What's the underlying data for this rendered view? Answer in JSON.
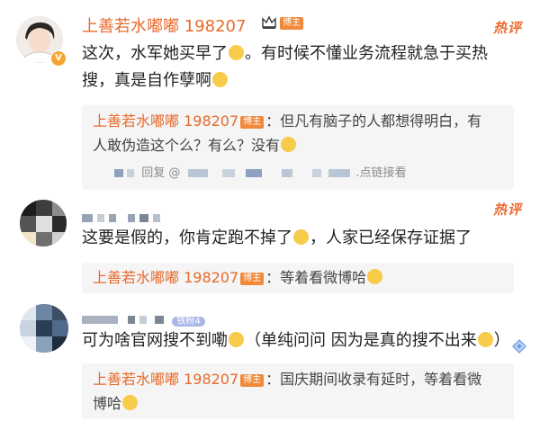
{
  "post": {
    "author": "上善若水嘟嘟 198207",
    "badge": "博主",
    "hot_label": "热评",
    "text_1": "这次，水军她买早了",
    "text_2": "。有时候不懂业务流程就急于买热",
    "text_3": "搜，真是自作孽啊",
    "reply": {
      "author": "上善若水嘟嘟 198207",
      "badge": "博主",
      "text_1": "：但凡有脑子的人都想得明白，有",
      "text_2": "人敢伪造这个么？有么？没有",
      "footer_reply": "回复 @",
      "footer_link": "点链接看"
    }
  },
  "comment2": {
    "hot_label": "热评",
    "text": "这要是假的，你肯定跑不掉了",
    "text_tail": "，人家已经保存证据了",
    "reply": {
      "author": "上善若水嘟嘟 198207",
      "badge": "博主",
      "text": "：等着看微博哈"
    }
  },
  "comment3": {
    "fan_badge": "铁粉4",
    "text": "可为啥官网搜不到嘞",
    "text_tail": "（单纯问问 因为是真的搜不出来",
    "text_end": "）",
    "reply": {
      "author": "上善若水嘟嘟 198207",
      "badge": "博主",
      "text_1": "：国庆期间收录有延时，等着看微",
      "text_2": "博哈"
    }
  },
  "icons": {
    "crown": "crown-icon",
    "verified": "verified-v-icon",
    "emoji": "grin-emoji-icon",
    "diamond": "diamond-icon"
  },
  "colors": {
    "username": "#e86a2a",
    "hot": "#ee6a2e",
    "reply_bg": "#f5f5f6",
    "badge_bg": "#f08a3a"
  }
}
